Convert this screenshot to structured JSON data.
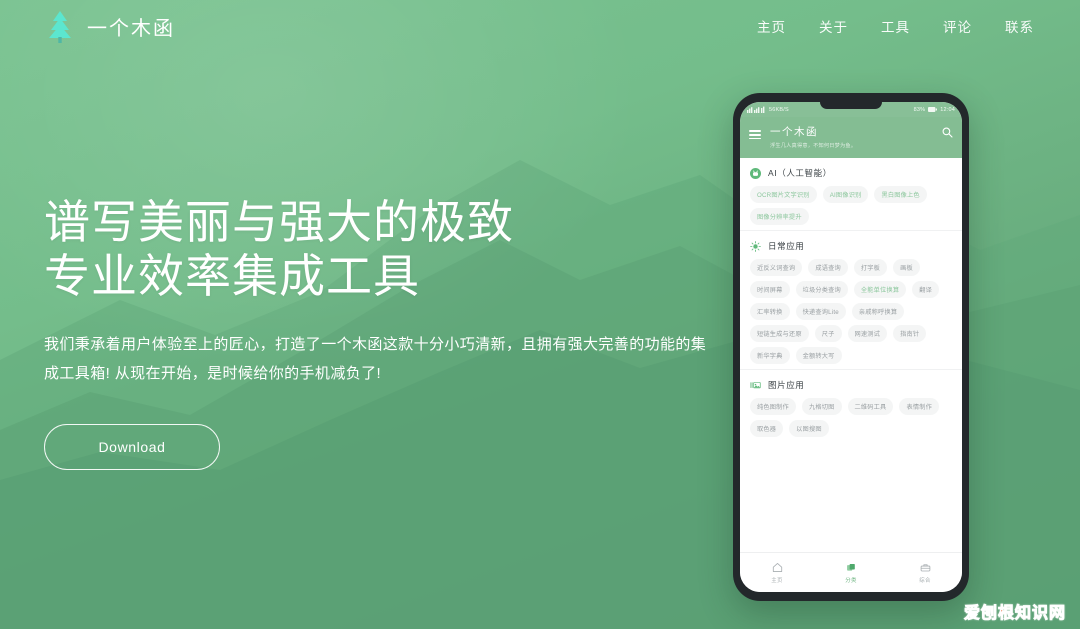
{
  "theme": {
    "bg_top": "#7ac391",
    "bg_bottom": "#5d9d74",
    "accent": "#8cc79d",
    "appbar_green": "#84bd93",
    "logo_cyan": "#5ce6cf",
    "watermark_color": "#e2541f"
  },
  "header": {
    "brand_name": "一个木函",
    "brand_icon": "pine-tree-icon",
    "nav": [
      {
        "label": "主页"
      },
      {
        "label": "关于"
      },
      {
        "label": "工具"
      },
      {
        "label": "评论"
      },
      {
        "label": "联系"
      }
    ]
  },
  "hero": {
    "headline_line1": "谱写美丽与强大的极致",
    "headline_line2": "专业效率集成工具",
    "subtitle": "我们秉承着用户体验至上的匠心，打造了一个木函这款十分小巧清新，且拥有强大完善的功能的集成工具箱! 从现在开始，是时候给你的手机减负了!",
    "download_label": "Download"
  },
  "phone": {
    "statusbar": {
      "left": "56KB/S",
      "battery": "83%",
      "time": "12:04"
    },
    "appbar": {
      "menu_icon": "hamburger-icon",
      "title": "一个木函",
      "subtitle": "浮生几人真得意，不知何日梦为鱼。",
      "search_icon": "search-icon"
    },
    "sections": [
      {
        "icon": "android-robot-icon",
        "title": "AI（人工智能）",
        "chips": [
          {
            "label": "OCR图片文字识别",
            "accent": true
          },
          {
            "label": "AI图像识别",
            "accent": true
          },
          {
            "label": "黑白图像上色",
            "accent": true
          },
          {
            "label": "图像分辨率提升",
            "accent": true
          }
        ]
      },
      {
        "icon": "sun-icon",
        "title": "日常应用",
        "chips": [
          {
            "label": "近反义词查询",
            "accent": false
          },
          {
            "label": "成语查询",
            "accent": false
          },
          {
            "label": "打字板",
            "accent": false
          },
          {
            "label": "画板",
            "accent": false
          },
          {
            "label": "时间屏幕",
            "accent": false
          },
          {
            "label": "垃圾分类查询",
            "accent": false
          },
          {
            "label": "全能单位换算",
            "accent": true
          },
          {
            "label": "翻译",
            "accent": false
          },
          {
            "label": "汇率转换",
            "accent": false
          },
          {
            "label": "快递查询Lite",
            "accent": false
          },
          {
            "label": "亲戚称呼换算",
            "accent": false
          },
          {
            "label": "短链生成与还原",
            "accent": false
          },
          {
            "label": "尺子",
            "accent": false
          },
          {
            "label": "网速测试",
            "accent": false
          },
          {
            "label": "指南针",
            "accent": false
          },
          {
            "label": "新华字典",
            "accent": false
          },
          {
            "label": "金额转大写",
            "accent": false
          }
        ]
      },
      {
        "icon": "image-icon",
        "title": "图片应用",
        "chips": [
          {
            "label": "纯色图制作",
            "accent": false
          },
          {
            "label": "九格切图",
            "accent": false
          },
          {
            "label": "二维码工具",
            "accent": false
          },
          {
            "label": "表情制作",
            "accent": false
          },
          {
            "label": "取色器",
            "accent": false
          },
          {
            "label": "以图搜图",
            "accent": false
          }
        ]
      }
    ],
    "bottom_nav": [
      {
        "label": "主页",
        "icon": "home-icon",
        "active": false
      },
      {
        "label": "分类",
        "icon": "layers-icon",
        "active": true
      },
      {
        "label": "综合",
        "icon": "toolbox-icon",
        "active": false
      }
    ]
  },
  "watermark": {
    "text": "爱刨根知识网"
  }
}
